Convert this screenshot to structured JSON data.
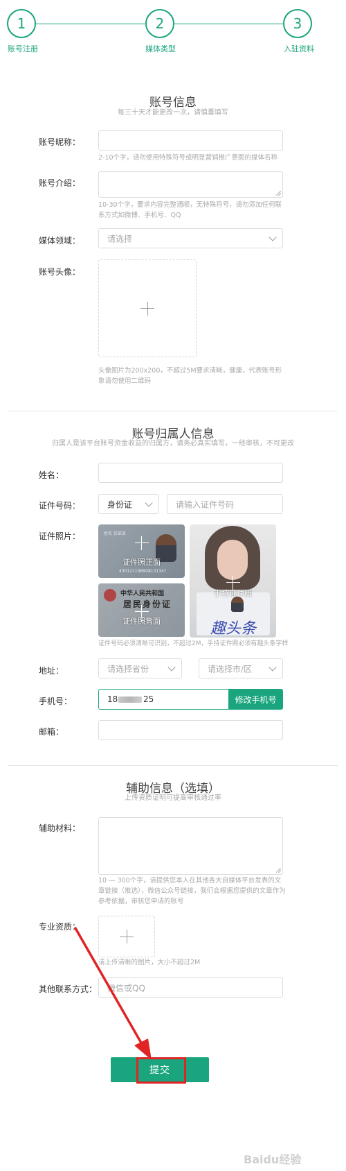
{
  "steps": [
    {
      "number": "1",
      "label": "账号注册"
    },
    {
      "number": "2",
      "label": "媒体类型"
    },
    {
      "number": "3",
      "label": "入驻资料"
    }
  ],
  "account_info": {
    "title": "账号信息",
    "subtitle": "每三十天才能更改一次，请慎重填写",
    "nickname_label": "账号昵称：",
    "nickname_hint": "2-10个字，请勿使用特殊符号或明显营销推广意图的媒体名称",
    "intro_label": "账号介绍：",
    "intro_hint": "10-30个字，要求内容完整通顺，无特殊符号，请勿添加任何联系方式如微博、手机号、QQ",
    "domain_label": "媒体领域：",
    "domain_placeholder": "请选择",
    "avatar_label": "账号头像：",
    "avatar_hint": "头像图片为200x200，不超过5M要求清晰，健康，代表账号形象请勿使用二维码"
  },
  "owner_info": {
    "title": "账号归属人信息",
    "subtitle": "归属人是该平台账号资金收益的归属方，请务必真实填写，一经审核，不可更改",
    "name_label": "姓名：",
    "id_label": "证件号码：",
    "id_type": "身份证",
    "id_placeholder": "请输入证件号码",
    "photo_label": "证件照片：",
    "photo_front": "证件照正面",
    "photo_back": "证件照背面",
    "photo_handheld": "手持证件照",
    "card_front_name": "姓名 张某某",
    "card_front_number": "43012119890813134?",
    "card_back_country": "中华人民共和国",
    "card_back_title": "居民身份证",
    "handheld_sign": "趣头条",
    "photo_hint": "证件号码必须清晰可识别，不超过2M，手持证件照必须有趣头条字样",
    "address_label": "地址：",
    "province_placeholder": "请选择省份",
    "city_placeholder": "请选择市/区",
    "phone_label": "手机号：",
    "phone_value_start": "18",
    "phone_value_end": "25",
    "change_phone_button": "修改手机号",
    "email_label": "邮箱："
  },
  "aux_info": {
    "title": "辅助信息（选填）",
    "subtitle": "上传资质证明可提高审核通过率",
    "materials_label": "辅助材料：",
    "materials_hint": "10 — 300个字，请提供您本人在其他各大自媒体平台发表的文章链接（推选），微信公众号链接，我们会根据您提供的文章作为参考依据，审核您申请的账号",
    "qualification_label": "专业资质：",
    "qualification_hint": "请上传清晰的图片，大小不超过2M",
    "contact_label": "其他联系方式：",
    "contact_placeholder": "微信或QQ"
  },
  "submit_button": "提交",
  "watermark": "Baidu经验",
  "colors": {
    "accent": "#1aa57e",
    "annotation": "#e02424"
  }
}
